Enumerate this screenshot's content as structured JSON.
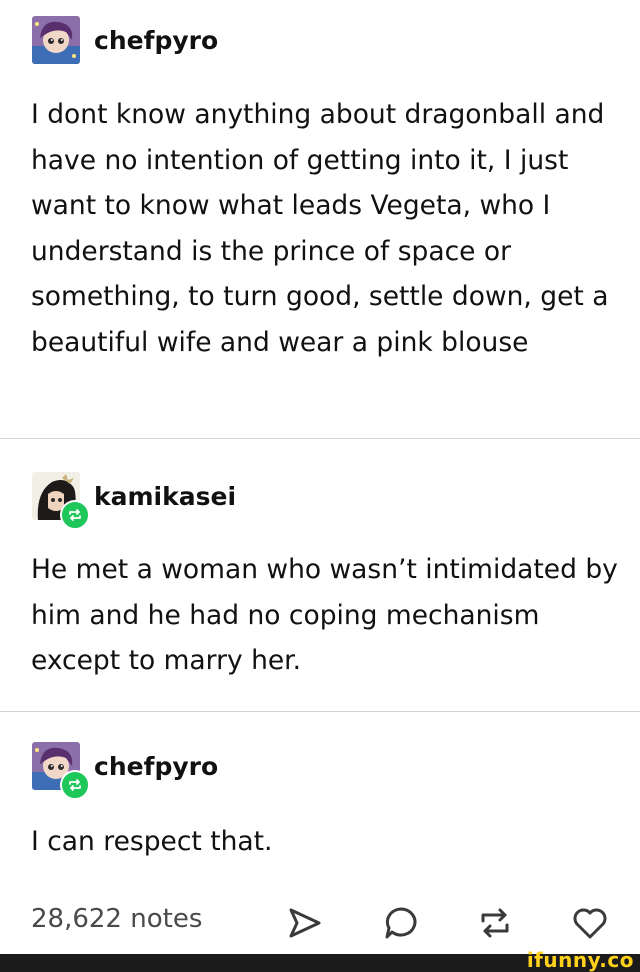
{
  "posts": [
    {
      "username": "chefpyro",
      "text": "I dont know anything about dragonball and have no intention of getting into it, I just want to know what leads Vegeta, who I understand is the prince of space or something, to turn good, settle down, get a beautiful wife and wear a pink blouse",
      "reblog": false
    },
    {
      "username": "kamikasei",
      "text": "He met a woman who wasn’t intimidated by him and he had no coping mechanism except to marry her.",
      "reblog": true
    },
    {
      "username": "chefpyro",
      "text": "I can respect that.",
      "reblog": true
    }
  ],
  "footer": {
    "notes_label": "28,622 notes",
    "icons": [
      "share-icon",
      "reply-icon",
      "reblog-icon",
      "like-icon"
    ]
  },
  "watermark": "ifunny.co",
  "colors": {
    "reblog_green": "#1ec75a",
    "text": "#111111",
    "notes_gray": "#4a4a4a",
    "divider": "#d4d4d4",
    "watermark_yellow": "#ffd11a"
  }
}
